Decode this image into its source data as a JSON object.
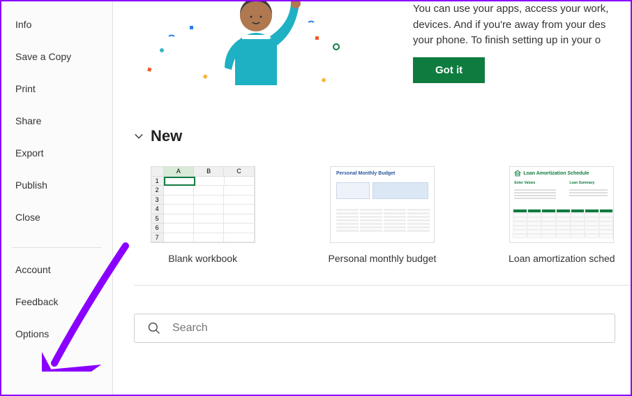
{
  "sidebar": {
    "items_main": [
      {
        "label": "Info"
      },
      {
        "label": "Save a Copy"
      },
      {
        "label": "Print"
      },
      {
        "label": "Share"
      },
      {
        "label": "Export"
      },
      {
        "label": "Publish"
      },
      {
        "label": "Close"
      }
    ],
    "items_bottom": [
      {
        "label": "Account"
      },
      {
        "label": "Feedback"
      },
      {
        "label": "Options"
      }
    ]
  },
  "banner": {
    "description": "You can use your apps, access your work, devices. And if you're away from your des your phone. To finish setting up in your o",
    "button_label": "Got it"
  },
  "new_section": {
    "title": "New",
    "templates": [
      {
        "label": "Blank workbook"
      },
      {
        "label": "Personal monthly budget"
      },
      {
        "label": "Loan amortization sched"
      }
    ]
  },
  "search": {
    "placeholder": "Search"
  },
  "colors": {
    "accent": "#0e7c3f",
    "annotation": "#8a00ff"
  },
  "thumb_budget_title": "Personal Monthly Budget",
  "thumb_loan_title": "Loan Amortization Schedule",
  "thumb_loan_h1": "Enter Values",
  "thumb_loan_h2": "Loan Summary"
}
